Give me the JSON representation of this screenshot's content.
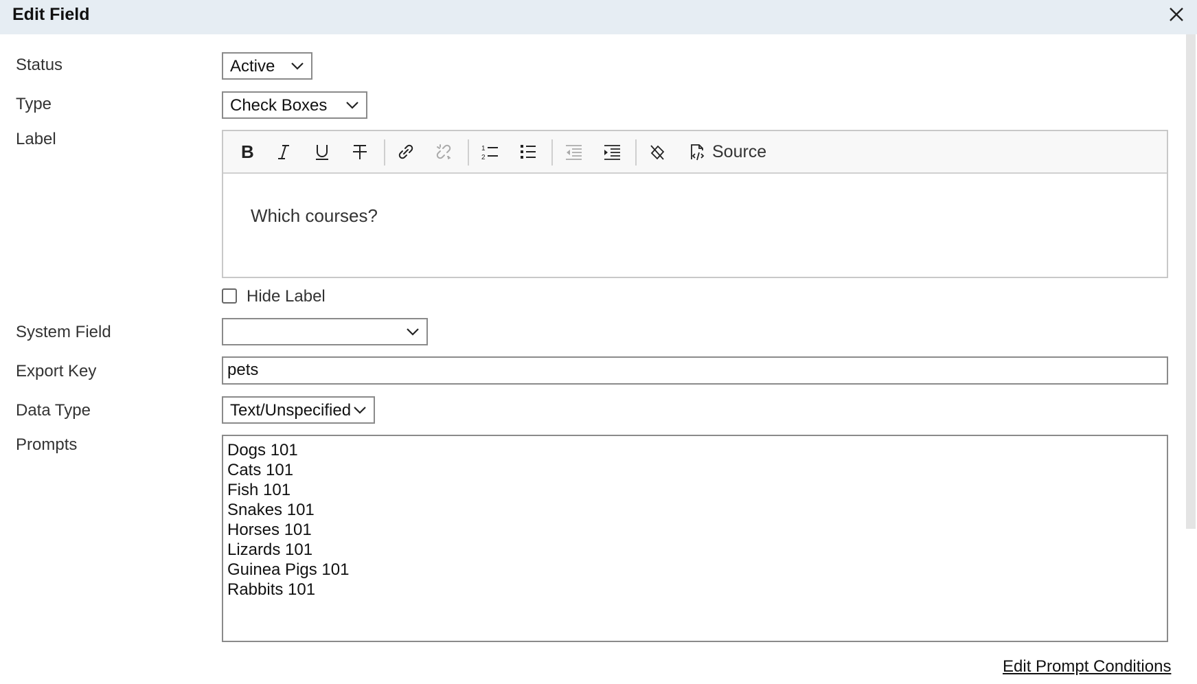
{
  "dialog": {
    "title": "Edit Field"
  },
  "fields": {
    "status": {
      "label": "Status",
      "value": "Active"
    },
    "type": {
      "label": "Type",
      "value": "Check Boxes"
    },
    "label": {
      "label": "Label",
      "content": "Which courses?",
      "toolbar": {
        "source_label": "Source",
        "buttons": [
          "bold-icon",
          "italic-icon",
          "underline-icon",
          "strikethrough-icon",
          "link-icon",
          "unlink-icon",
          "numbered-list-icon",
          "bulleted-list-icon",
          "outdent-icon",
          "indent-icon",
          "remove-format-icon",
          "source-icon"
        ]
      }
    },
    "hide_label": {
      "label": "Hide Label",
      "checked": false
    },
    "system_field": {
      "label": "System Field",
      "value": ""
    },
    "export_key": {
      "label": "Export Key",
      "value": "pets"
    },
    "data_type": {
      "label": "Data Type",
      "value": "Text/Unspecified"
    },
    "prompts": {
      "label": "Prompts",
      "items": [
        "Dogs 101",
        "Cats 101",
        "Fish 101",
        "Snakes 101",
        "Horses 101",
        "Lizards 101",
        "Guinea Pigs 101",
        "Rabbits 101"
      ]
    }
  },
  "links": {
    "edit_prompt_conditions": "Edit Prompt Conditions"
  },
  "colors": {
    "titlebar_bg": "#e6edf3",
    "border": "#8a8a8a"
  }
}
